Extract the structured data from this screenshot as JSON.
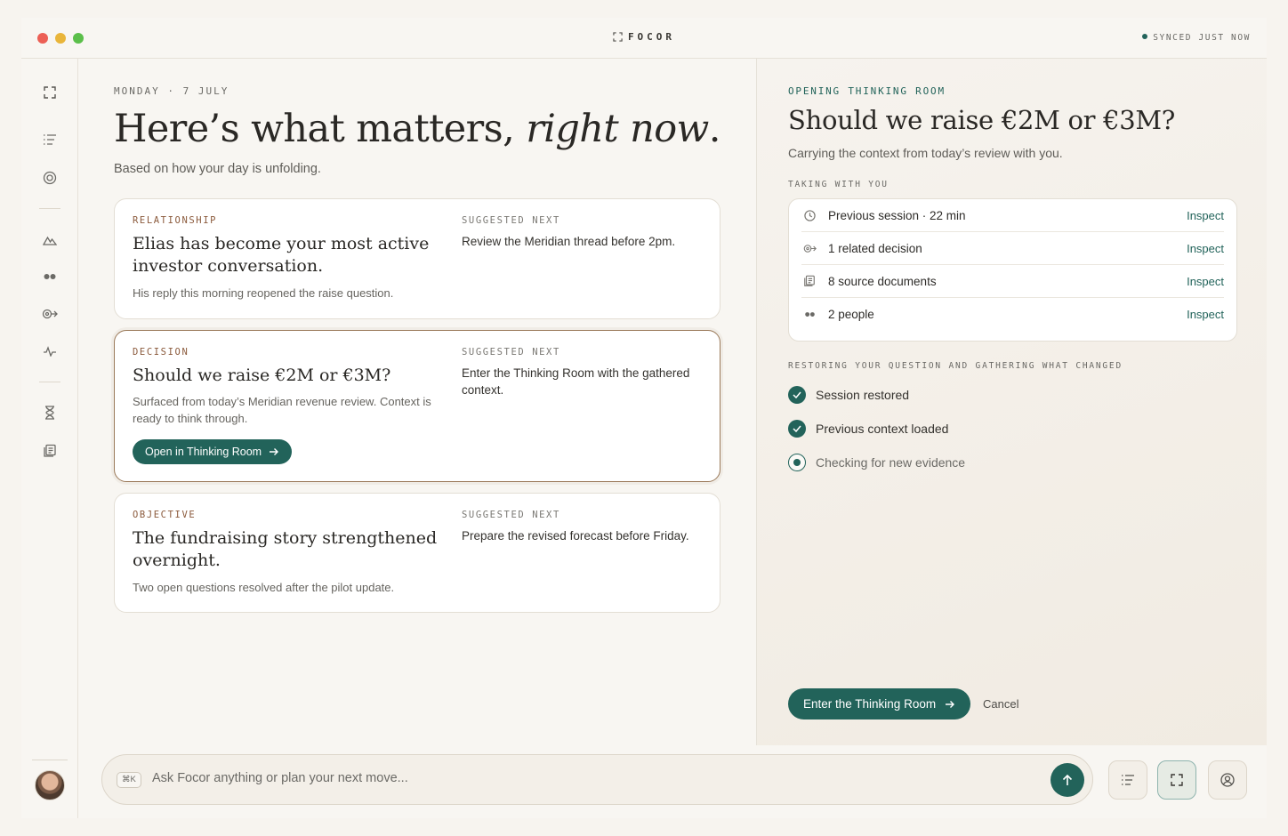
{
  "app": {
    "brand": "FOCOR",
    "sync_status": "SYNCED JUST NOW"
  },
  "sidebar": {
    "icons": [
      "focus-icon",
      "list-icon",
      "target-icon",
      "mountain-icon",
      "people-icon",
      "link-arrow-icon",
      "pulse-icon",
      "hourglass-icon",
      "documents-icon"
    ]
  },
  "main": {
    "date": "MONDAY · 7 JULY",
    "headline_start": "Here’s what matters, ",
    "headline_italic": "right now",
    "headline_end": ".",
    "subhead": "Based on how your day is unfolding.",
    "cards": [
      {
        "tag": "RELATIONSHIP",
        "title": "Elias has become your most active investor conversation.",
        "body": "His reply this morning reopened the raise question.",
        "suggested_label": "SUGGESTED NEXT",
        "suggested": "Review the Meridian thread before 2pm."
      },
      {
        "tag": "DECISION",
        "title": "Should we raise €2M or €3M?",
        "body": "Surfaced from today’s Meridian revenue review. Context is ready to think through.",
        "suggested_label": "SUGGESTED NEXT",
        "suggested": "Enter the Thinking Room with the gathered context.",
        "button": "Open in Thinking Room"
      },
      {
        "tag": "OBJECTIVE",
        "title": "The fundraising story strengthened overnight.",
        "body": "Two open questions resolved after the pilot update.",
        "suggested_label": "SUGGESTED NEXT",
        "suggested": "Prepare the revised forecast before Friday."
      }
    ]
  },
  "panel": {
    "eyebrow": "OPENING THINKING ROOM",
    "title": "Should we raise €2M or €3M?",
    "subtitle": "Carrying the context from today’s review with you.",
    "taking_label": "TAKING WITH YOU",
    "items": [
      {
        "icon": "clock-icon",
        "label": "Previous session · 22 min",
        "action": "Inspect"
      },
      {
        "icon": "link-arrow-icon",
        "label": "1 related decision",
        "action": "Inspect"
      },
      {
        "icon": "documents-icon",
        "label": "8 source documents",
        "action": "Inspect"
      },
      {
        "icon": "people-icon",
        "label": "2 people",
        "action": "Inspect"
      }
    ],
    "restoring_label": "RESTORING YOUR QUESTION AND GATHERING WHAT CHANGED",
    "steps": [
      {
        "label": "Session restored",
        "state": "done"
      },
      {
        "label": "Previous context loaded",
        "state": "done"
      },
      {
        "label": "Checking for new evidence",
        "state": "in-progress"
      }
    ],
    "primary_button": "Enter the Thinking Room",
    "cancel": "Cancel"
  },
  "bottom": {
    "shortcut": "⌘K",
    "placeholder": "Ask Focor anything or plan your next move..."
  },
  "colors": {
    "accent": "#22635a",
    "tag": "#8b5a3c",
    "active_border": "#9b7a5a"
  }
}
